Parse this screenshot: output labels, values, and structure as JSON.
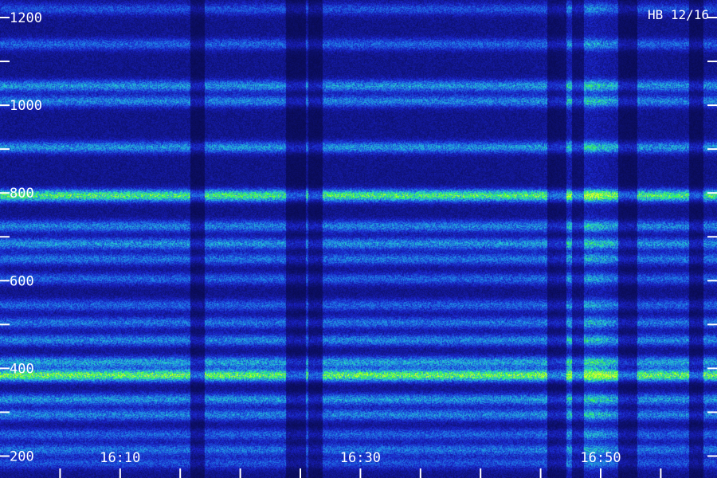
{
  "chart_data": {
    "type": "heatmap",
    "title": "",
    "xlabel": "",
    "ylabel": "",
    "annotation": "HB 12/16",
    "x_tick_labels": [
      "16:10",
      "16:30",
      "16:50"
    ],
    "x_range_minutes": [
      16.0,
      16.0
    ],
    "x_start": "16:00",
    "x_end": "16:59",
    "x_minor_tick_minutes": [
      5,
      10,
      15,
      20,
      25,
      30,
      35,
      40,
      45,
      50,
      55
    ],
    "y_tick_labels": [
      "200",
      "400",
      "600",
      "800",
      "1000",
      "1200"
    ],
    "y_tick_values": [
      200,
      400,
      600,
      800,
      1000,
      1200
    ],
    "y_minor_tick_values": [
      300,
      500,
      700,
      900,
      1100
    ],
    "ylim": [
      150,
      1240
    ],
    "colormap": [
      "#06063a",
      "#1a22c8",
      "#1f7fe8",
      "#28d6c8",
      "#3aff3a",
      "#d8ff30"
    ],
    "bands": [
      {
        "y": 1220,
        "intensity": 0.25
      },
      {
        "y": 1140,
        "intensity": 0.3
      },
      {
        "y": 1045,
        "intensity": 0.45
      },
      {
        "y": 1010,
        "intensity": 0.4
      },
      {
        "y": 905,
        "intensity": 0.45
      },
      {
        "y": 795,
        "intensity": 0.85
      },
      {
        "y": 725,
        "intensity": 0.4
      },
      {
        "y": 685,
        "intensity": 0.45
      },
      {
        "y": 650,
        "intensity": 0.35
      },
      {
        "y": 605,
        "intensity": 0.3
      },
      {
        "y": 545,
        "intensity": 0.3
      },
      {
        "y": 505,
        "intensity": 0.35
      },
      {
        "y": 465,
        "intensity": 0.4
      },
      {
        "y": 415,
        "intensity": 0.5
      },
      {
        "y": 385,
        "intensity": 0.95
      },
      {
        "y": 330,
        "intensity": 0.45
      },
      {
        "y": 295,
        "intensity": 0.4
      },
      {
        "y": 250,
        "intensity": 0.3
      },
      {
        "y": 215,
        "intensity": 0.35
      },
      {
        "y": 185,
        "intensity": 0.25
      }
    ],
    "dropout_columns": [
      {
        "x_minute": 16.4,
        "width_minutes": 0.6
      },
      {
        "x_minute": 24.6,
        "width_minutes": 0.8
      },
      {
        "x_minute": 26.2,
        "width_minutes": 0.6
      },
      {
        "x_minute": 46.3,
        "width_minutes": 0.8
      },
      {
        "x_minute": 48.1,
        "width_minutes": 0.5
      },
      {
        "x_minute": 52.2,
        "width_minutes": 0.8
      },
      {
        "x_minute": 57.9,
        "width_minutes": 0.6
      }
    ],
    "bright_burst": {
      "x_minute": 48.6,
      "width_minutes": 2.6
    }
  }
}
